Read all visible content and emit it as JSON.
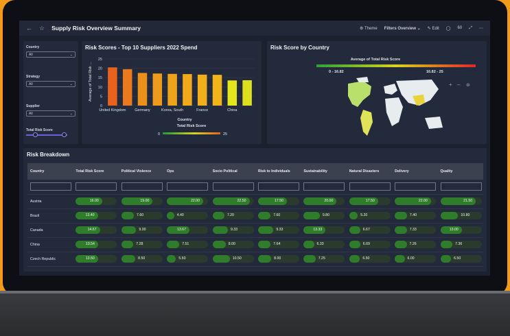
{
  "header": {
    "title": "Supply Risk Overview Summary",
    "theme_label": "Theme",
    "filters_label": "Filters Overview",
    "edit_label": "Edit",
    "zoom_label": "60"
  },
  "filters": {
    "country": {
      "label": "Country",
      "value": "All"
    },
    "strategy": {
      "label": "Strategy",
      "value": "All"
    },
    "supplier": {
      "label": "Supplier",
      "value": "All"
    },
    "risk_score": {
      "label": "Total Risk Score",
      "range": [
        0.22,
        0.92
      ]
    }
  },
  "chart_data": [
    {
      "type": "bar",
      "title": "Risk Scores - Top 10 Suppliers 2022 Spend",
      "ylabel": "Average of Total Risk ...",
      "xlabel": "Country",
      "ylim": [
        0,
        25
      ],
      "yticks": [
        0,
        5,
        10,
        15,
        20,
        25
      ],
      "tick_labels": [
        "United Kingdom",
        "Germany",
        "Korea, South",
        "France",
        "China"
      ],
      "values": [
        20.5,
        19.5,
        17.5,
        17.2,
        17.0,
        16.9,
        16.6,
        16.5,
        13.5,
        13.6
      ],
      "bar_colors": [
        "#e8621d",
        "#ea7a1d",
        "#ec901c",
        "#ee9a1c",
        "#efa31c",
        "#f0aa1c",
        "#f1b01b",
        "#f2b41b",
        "#e4e61c",
        "#dde01c"
      ],
      "legend_title": "Total Risk Score",
      "legend_range": [
        "0",
        "25"
      ]
    },
    {
      "type": "heatmap",
      "title": "Risk Score by Country",
      "legend_title": "Average of Total Risk Score",
      "legend_bins": [
        "0 - 16.82",
        "16.82 - 25"
      ]
    }
  ],
  "table": {
    "title": "Risk Breakdown",
    "columns": [
      "Country",
      "Total Risk Score",
      "Political Violence",
      "Ops",
      "Socio Political",
      "Risk to Individuals",
      "Sustainability",
      "Natural Disasters",
      "Delivery",
      "Quality"
    ],
    "rows": [
      {
        "country": "Austria",
        "values": [
          "16.00",
          "19.00",
          "22.00",
          "22.50",
          "17.50",
          "20.00",
          "17.50",
          "22.00",
          "21.50"
        ]
      },
      {
        "country": "Brazil",
        "values": [
          "13.40",
          "7.60",
          "4.40",
          "7.20",
          "7.60",
          "9.80",
          "5.20",
          "7.40",
          "10.80"
        ]
      },
      {
        "country": "Canada",
        "values": [
          "14.67",
          "9.00",
          "13.67",
          "9.33",
          "9.33",
          "13.33",
          "6.67",
          "7.33",
          "13.00"
        ]
      },
      {
        "country": "China",
        "values": [
          "13.54",
          "7.28",
          "7.51",
          "8.00",
          "7.64",
          "6.33",
          "6.69",
          "7.26",
          "7.36"
        ]
      },
      {
        "country": "Czech Republic",
        "values": [
          "13.50",
          "8.50",
          "5.50",
          "10.50",
          "8.00",
          "7.25",
          "6.50",
          "6.00",
          "6.50"
        ]
      }
    ]
  },
  "colors": {
    "accent": "#6d63d6",
    "good": "#2f7d2a",
    "bg": "#1c2130"
  }
}
